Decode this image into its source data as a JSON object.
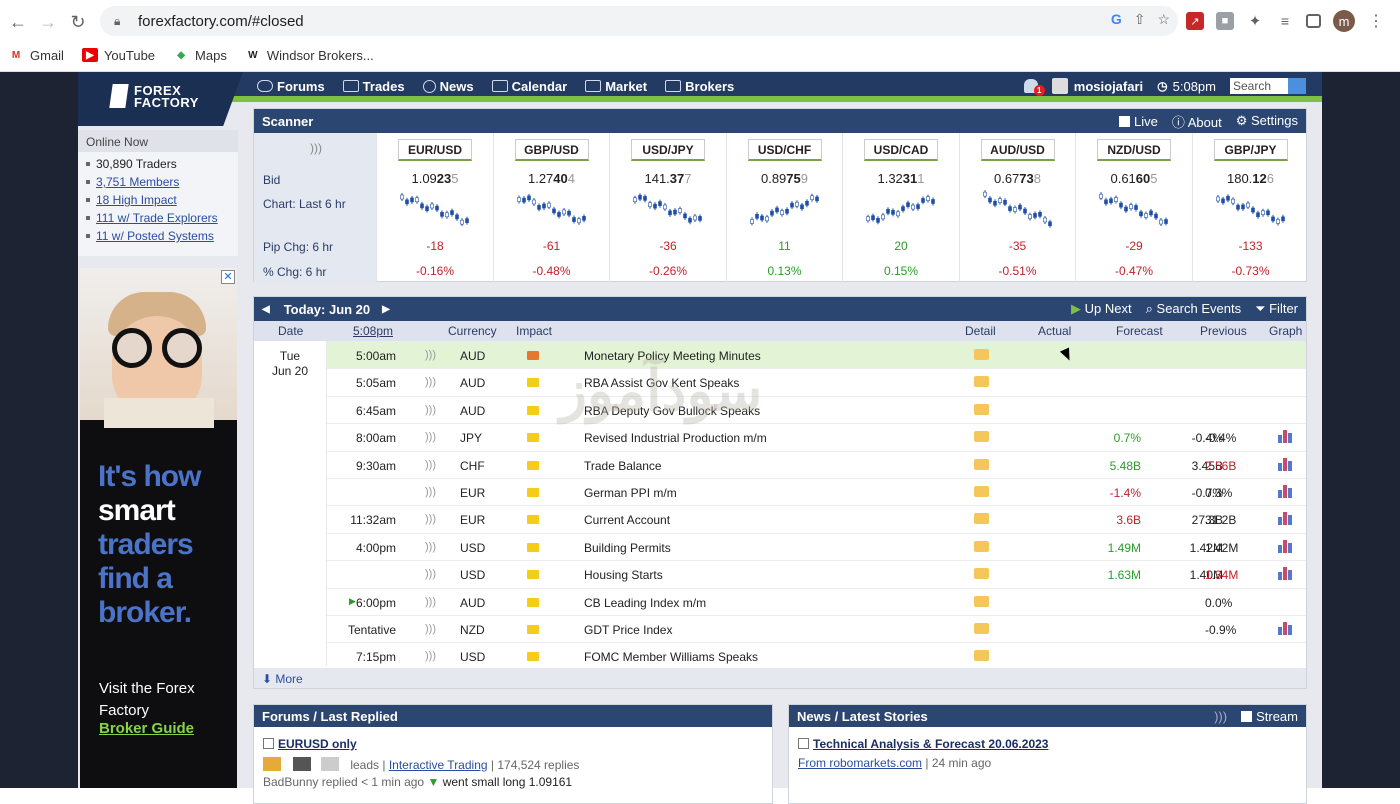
{
  "browser": {
    "url": "forexfactory.com/#closed",
    "profile_initial": "m",
    "bookmarks": [
      {
        "label": "Gmail",
        "icon": "gmail-icon",
        "color": "#d93025"
      },
      {
        "label": "YouTube",
        "icon": "youtube-icon",
        "color": "#e00"
      },
      {
        "label": "Maps",
        "icon": "maps-icon",
        "color": "#34a853"
      },
      {
        "label": "Windsor Brokers...",
        "icon": "windsor-icon",
        "color": "#222"
      }
    ]
  },
  "site": {
    "logo_line1": "FOREX",
    "logo_line2": "FACTORY",
    "nav": [
      "Forums",
      "Trades",
      "News",
      "Calendar",
      "Market",
      "Brokers"
    ],
    "notifications": "1",
    "username": "mosiojafari",
    "time": "5:08pm",
    "search_placeholder": "Search"
  },
  "online": {
    "title": "Online Now",
    "items": [
      "30,890 Traders",
      "3,751 Members",
      "18 High Impact",
      "111 w/ Trade Explorers",
      "11 w/ Posted Systems"
    ]
  },
  "ad": {
    "line1": "It's how",
    "line2": "smart",
    "line3": "traders find a broker.",
    "visit": "Visit the Forex Factory",
    "guide": "Broker Guide",
    "close": "✕"
  },
  "scanner": {
    "title": "Scanner",
    "live": "Live",
    "about": "About",
    "settings": "Settings",
    "labels": {
      "bid": "Bid",
      "chart": "Chart: Last 6 hr",
      "pip": "Pip Chg: 6 hr",
      "pct": "% Chg: 6 hr"
    },
    "pairs": [
      {
        "pair": "EUR/USD",
        "bid_a": "1.09",
        "bid_b": "23",
        "bid_c": "5",
        "pip": "-18",
        "pct": "-0.16%",
        "trend": "down"
      },
      {
        "pair": "GBP/USD",
        "bid_a": "1.27",
        "bid_b": "40",
        "bid_c": "4",
        "pip": "-61",
        "pct": "-0.48%",
        "trend": "down"
      },
      {
        "pair": "USD/JPY",
        "bid_a": "141.",
        "bid_b": "37",
        "bid_c": "7",
        "pip": "-36",
        "pct": "-0.26%",
        "trend": "down"
      },
      {
        "pair": "USD/CHF",
        "bid_a": "0.89",
        "bid_b": "75",
        "bid_c": "9",
        "pip": "11",
        "pct": "0.13%",
        "trend": "up"
      },
      {
        "pair": "USD/CAD",
        "bid_a": "1.32",
        "bid_b": "31",
        "bid_c": "1",
        "pip": "20",
        "pct": "0.15%",
        "trend": "up"
      },
      {
        "pair": "AUD/USD",
        "bid_a": "0.67",
        "bid_b": "73",
        "bid_c": "8",
        "pip": "-35",
        "pct": "-0.51%",
        "trend": "down"
      },
      {
        "pair": "NZD/USD",
        "bid_a": "0.61",
        "bid_b": "60",
        "bid_c": "5",
        "pip": "-29",
        "pct": "-0.47%",
        "trend": "down"
      },
      {
        "pair": "GBP/JPY",
        "bid_a": "180.",
        "bid_b": "12",
        "bid_c": "6",
        "pip": "-133",
        "pct": "-0.73%",
        "trend": "down"
      }
    ]
  },
  "calendar": {
    "today": "Today: Jun 20",
    "up_next": "Up Next",
    "search_events": "Search Events",
    "filter": "Filter",
    "headers": {
      "date": "Date",
      "time": "5:08pm",
      "currency": "Currency",
      "impact": "Impact",
      "detail": "Detail",
      "actual": "Actual",
      "forecast": "Forecast",
      "previous": "Previous",
      "graph": "Graph"
    },
    "day": "Tue",
    "date": "Jun 20",
    "more": "More",
    "events": [
      {
        "time": "5:00am",
        "cur": "AUD",
        "impact": "high",
        "event": "Monetary Policy Meeting Minutes",
        "actual": "",
        "actual_color": "",
        "forecast": "",
        "previous": "",
        "prev_color": "",
        "graph": false,
        "highlight": true
      },
      {
        "time": "5:05am",
        "cur": "AUD",
        "impact": "low",
        "event": "RBA Assist Gov Kent Speaks",
        "actual": "",
        "actual_color": "",
        "forecast": "",
        "previous": "",
        "prev_color": "",
        "graph": false,
        "highlight": false
      },
      {
        "time": "6:45am",
        "cur": "AUD",
        "impact": "low",
        "event": "RBA Deputy Gov Bullock Speaks",
        "actual": "",
        "actual_color": "",
        "forecast": "",
        "previous": "",
        "prev_color": "",
        "graph": false,
        "highlight": false
      },
      {
        "time": "8:00am",
        "cur": "JPY",
        "impact": "low",
        "event": "Revised Industrial Production m/m",
        "actual": "0.7%",
        "actual_color": "pos",
        "forecast": "-0.4%",
        "previous": "-0.4%",
        "prev_color": "",
        "graph": true,
        "highlight": false
      },
      {
        "time": "9:30am",
        "cur": "CHF",
        "impact": "low",
        "event": "Trade Balance",
        "actual": "5.48B",
        "actual_color": "pos",
        "forecast": "3.45B",
        "previous": "2.56B",
        "prev_color": "neg",
        "graph": true,
        "highlight": false
      },
      {
        "time": "",
        "cur": "EUR",
        "impact": "low",
        "event": "German PPI m/m",
        "actual": "-1.4%",
        "actual_color": "neg",
        "forecast": "-0.7%",
        "previous": "0.3%",
        "prev_color": "",
        "graph": true,
        "highlight": false
      },
      {
        "time": "11:32am",
        "cur": "EUR",
        "impact": "low",
        "event": "Current Account",
        "actual": "3.6B",
        "actual_color": "neg",
        "forecast": "27.3B",
        "previous": "31.2B",
        "prev_color": "",
        "graph": true,
        "highlight": false
      },
      {
        "time": "4:00pm",
        "cur": "USD",
        "impact": "low",
        "event": "Building Permits",
        "actual": "1.49M",
        "actual_color": "pos",
        "forecast": "1.42M",
        "previous": "1.42M",
        "prev_color": "",
        "graph": true,
        "highlight": false
      },
      {
        "time": "",
        "cur": "USD",
        "impact": "low",
        "event": "Housing Starts",
        "actual": "1.63M",
        "actual_color": "pos",
        "forecast": "1.40M",
        "previous": "1.34M",
        "prev_color": "neg",
        "graph": true,
        "highlight": false
      },
      {
        "time": "6:00pm",
        "cur": "AUD",
        "impact": "low",
        "event": "CB Leading Index m/m",
        "actual": "",
        "actual_color": "",
        "forecast": "",
        "previous": "0.0%",
        "prev_color": "",
        "graph": false,
        "highlight": false
      },
      {
        "time": "Tentative",
        "cur": "NZD",
        "impact": "low",
        "event": "GDT Price Index",
        "actual": "",
        "actual_color": "",
        "forecast": "",
        "previous": "-0.9%",
        "prev_color": "",
        "graph": true,
        "highlight": false
      },
      {
        "time": "7:15pm",
        "cur": "USD",
        "impact": "low",
        "event": "FOMC Member Williams Speaks",
        "actual": "",
        "actual_color": "",
        "forecast": "",
        "previous": "",
        "prev_color": "",
        "graph": false,
        "highlight": false
      }
    ]
  },
  "forums": {
    "title": "Forums / Last Replied",
    "thread": "EURUSD only",
    "leads": "leads",
    "category": "Interactive Trading",
    "replies": "174,524 replies",
    "last_user": "BadBunny replied < 1 min ago",
    "last_msg": "went small long 1.09161"
  },
  "news": {
    "title": "News / Latest Stories",
    "stream": "Stream",
    "story": "Technical Analysis & Forecast 20.06.2023",
    "source": "From robomarkets.com",
    "age": "24 min ago"
  },
  "watermark": "سودآموز"
}
